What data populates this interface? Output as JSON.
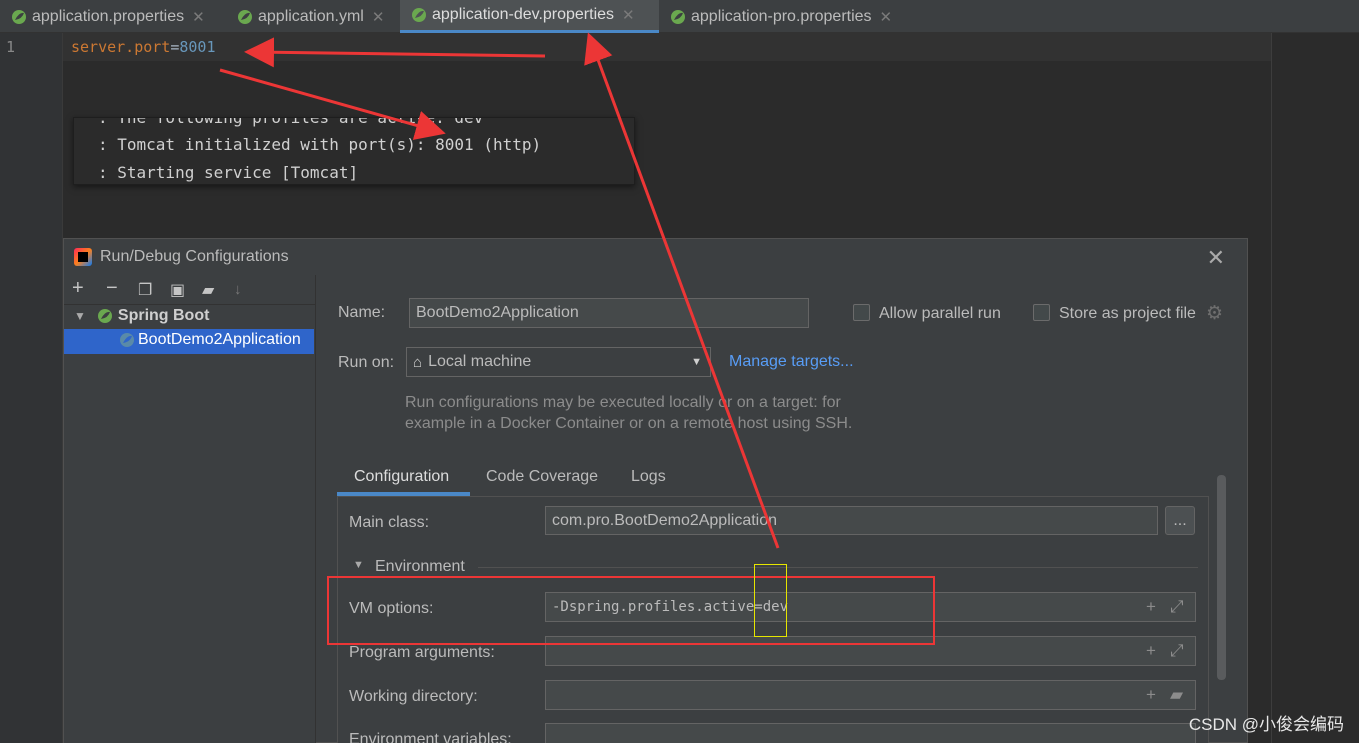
{
  "tabs": [
    {
      "label": "application.properties",
      "active": false
    },
    {
      "label": "application.yml",
      "active": false
    },
    {
      "label": "application-dev.properties",
      "active": true
    },
    {
      "label": "application-pro.properties",
      "active": false
    }
  ],
  "editor": {
    "line_number": "1",
    "key": "server.port",
    "eq": "=",
    "value": "8001"
  },
  "console": {
    "lines": [
      ": The following profiles are active: dev",
      ": Tomcat initialized with port(s): 8001 (http)",
      ": Starting service [Tomcat]"
    ]
  },
  "dialog": {
    "title": "Run/Debug Configurations",
    "tree": {
      "group": "Spring Boot",
      "item": "BootDemo2Application"
    },
    "name_label": "Name:",
    "name_value": "BootDemo2Application",
    "allow_parallel": "Allow parallel run",
    "store_project": "Store as project file",
    "run_on_label": "Run on:",
    "run_on_value": "Local machine",
    "manage_targets": "Manage targets...",
    "hint_line1": "Run configurations may be executed locally or on a target: for",
    "hint_line2": "example in a Docker Container or on a remote host using SSH.",
    "tabs": [
      "Configuration",
      "Code Coverage",
      "Logs"
    ],
    "main_class_label": "Main class:",
    "main_class_value": "com.pro.BootDemo2Application",
    "browse": "...",
    "environment": "Environment",
    "vm_options_label": "VM options:",
    "vm_options_value": "-Dspring.profiles.active=dev",
    "program_args_label": "Program arguments:",
    "working_dir_label": "Working directory:",
    "env_vars_label": "Environment variables:"
  },
  "watermark": "CSDN @小俊会编码",
  "colors": {
    "accent": "#4a88c7",
    "annotation_red": "#ec3636",
    "annotation_yellow": "#e6e600"
  }
}
